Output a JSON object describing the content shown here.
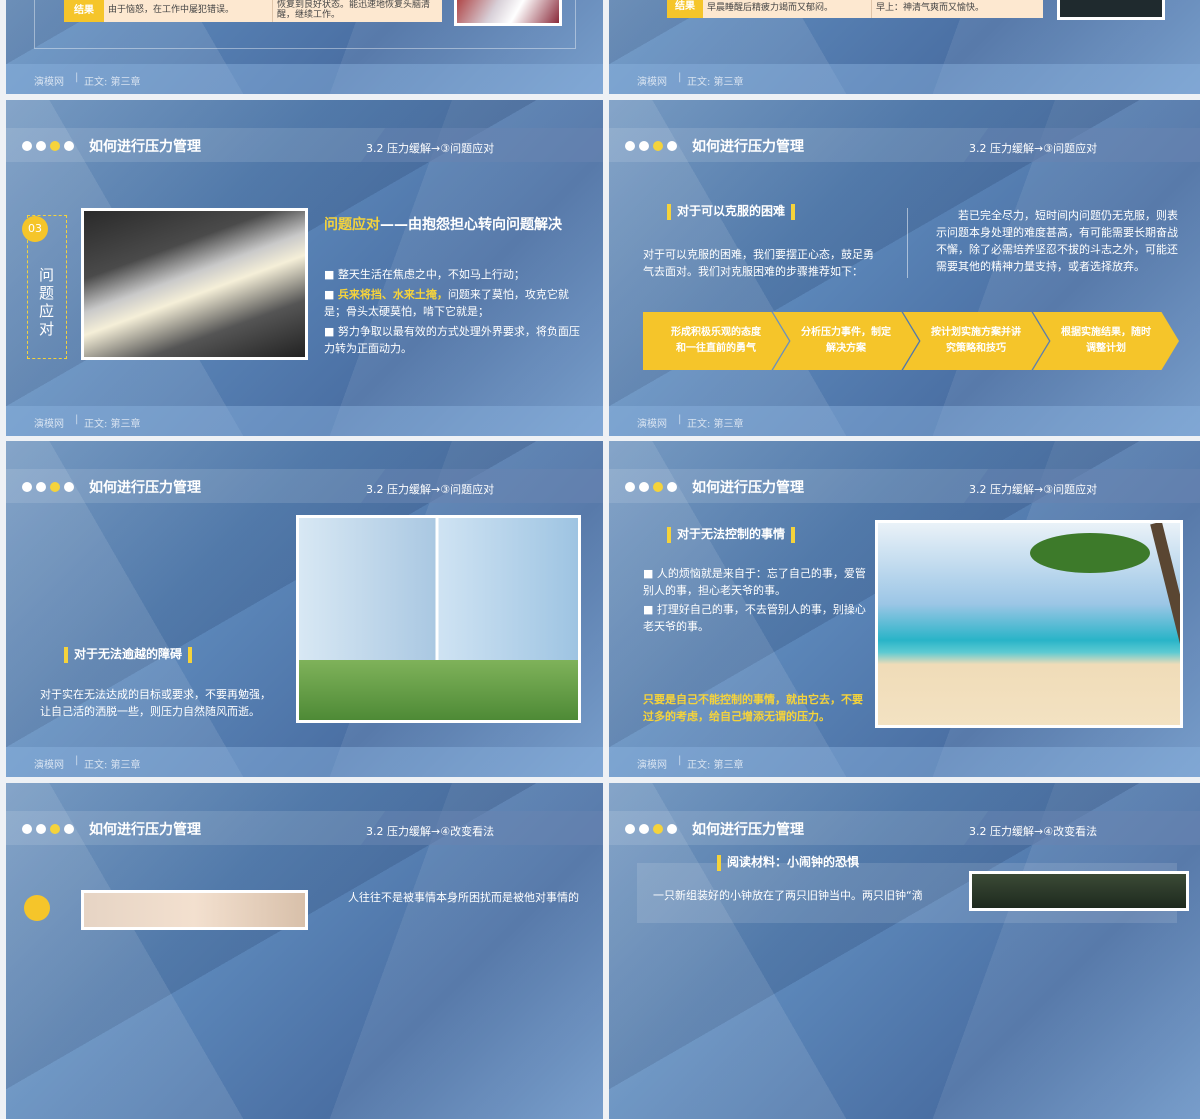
{
  "header": {
    "title": "如何进行压力管理"
  },
  "footer": {
    "brand": "演模网",
    "sep": "|",
    "chapter": "正文: 第三章"
  },
  "top": {
    "left": {
      "label": "结果",
      "cell1": "由于恼怒，在工作中屡犯错误。",
      "cell2": "恢复到良好状态。能迅速地恢复头脑清醒，继续工作。"
    },
    "right": {
      "label": "结果",
      "cell1": "早晨睡醒后精疲力竭而又郁闷。",
      "cell2": "早上：神清气爽而又愉快。"
    }
  },
  "s3": {
    "subtitle": "3.2 压力缓解→③问题应对",
    "badge": "03",
    "vertical_label": "问题应对",
    "heading_hl": "问题应对",
    "heading_rest": "——由抱怨担心转向问题解决",
    "b1": "整天生活在焦虑之中，不如马上行动；",
    "b2_hl": "兵来将挡、水来土掩，",
    "b2_rest": "问题来了莫怕，攻克它就是；骨头太硬莫怕，啃下它就是；",
    "b3": "努力争取以最有效的方式处理外界要求，将负面压力转为正面动力。"
  },
  "s4": {
    "subtitle": "3.2 压力缓解→③问题应对",
    "heading": "对于可以克服的困难",
    "left_para": "对于可以克服的困难，我们要摆正心态，鼓足勇气去面对。我们对克服困难的步骤推荐如下：",
    "right_para": "若已完全尽力，短时间内问题仍无克服，则表示问题本身处理的难度甚高，有可能需要长期奋战不懈，除了必需培养坚忍不拔的斗志之外，可能还需要其他的精神力量支持，或者选择放弃。",
    "steps": [
      "形成积极乐观的态度和一往直前的勇气",
      "分析压力事件，制定解决方案",
      "按计划实施方案并讲究策略和技巧",
      "根据实施结果，随时调整计划"
    ]
  },
  "s5": {
    "subtitle": "3.2 压力缓解→③问题应对",
    "heading": "对于无法逾越的障碍",
    "para": "对于实在无法达成的目标或要求，不要再勉强，让自己活的洒脱一些，则压力自然随风而逝。"
  },
  "s6": {
    "subtitle": "3.2 压力缓解→③问题应对",
    "heading": "对于无法控制的事情",
    "b1": "人的烦恼就是来自于：忘了自己的事，爱管别人的事，担心老天爷的事。",
    "b2": "打理好自己的事，不去管别人的事，别操心老天爷的事。",
    "highlight": "只要是自己不能控制的事情，就由它去，不要过多的考虑，给自己增添无谓的压力。"
  },
  "s7": {
    "subtitle": "3.2 压力缓解→④改变看法",
    "para": "人往往不是被事情本身所困扰而是被他对事情的"
  },
  "s8": {
    "subtitle": "3.2 压力缓解→④改变看法",
    "heading": "阅读材料：小闹钟的恐惧",
    "para": "一只新组装好的小钟放在了两只旧钟当中。两只旧钟“滴"
  },
  "colors": {
    "accent": "#f5d33b",
    "chevron": "#f5c52a",
    "text": "#ffffff"
  }
}
